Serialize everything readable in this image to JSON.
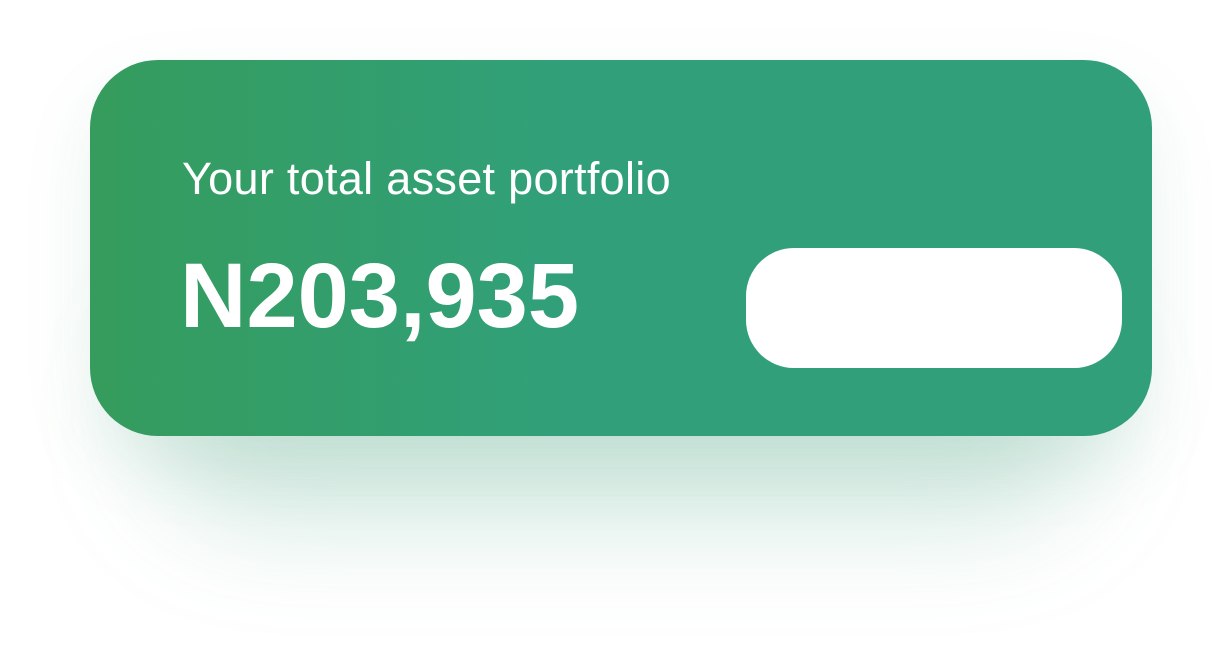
{
  "portfolio_card": {
    "label": "Your total asset portfolio",
    "amount": "N203,935",
    "action_button_label": ""
  },
  "colors": {
    "card_gradient_start": "#359c5d",
    "card_gradient_end": "#31a07a",
    "text": "#ffffff",
    "button_background": "#ffffff"
  }
}
